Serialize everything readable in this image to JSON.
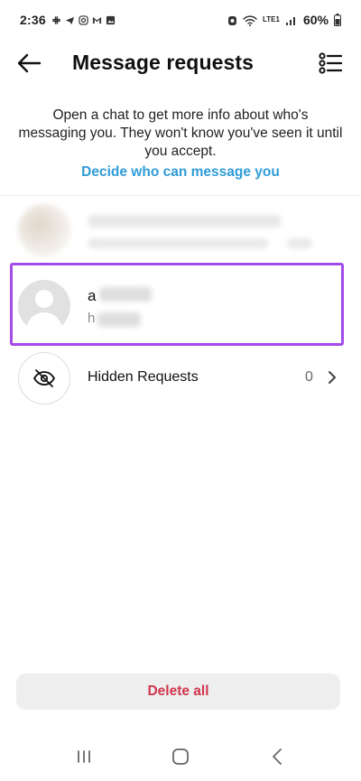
{
  "status_bar": {
    "time": "2:36",
    "battery": "60%",
    "network": "LTE1"
  },
  "header": {
    "title": "Message requests"
  },
  "info": {
    "text": "Open a chat to get more info about who's messaging you. They won't know you've seen it until you accept.",
    "link": "Decide who can message you"
  },
  "requests": {
    "active": {
      "name": "a",
      "preview": "h"
    }
  },
  "hidden_requests": {
    "label": "Hidden Requests",
    "count": "0"
  },
  "footer": {
    "delete_all": "Delete all"
  },
  "colors": {
    "accent_link": "#2f9cd6",
    "delete": "#d0364e",
    "highlight": "#a24be8"
  }
}
